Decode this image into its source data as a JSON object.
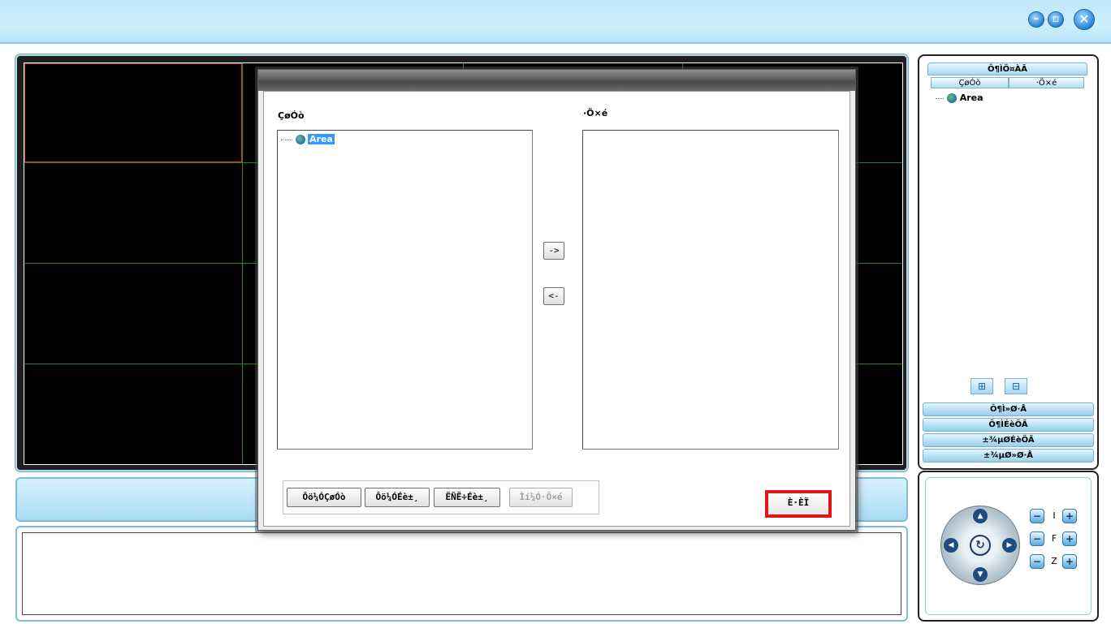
{
  "window": {
    "buttons": [
      {
        "name": "minimize",
        "glyph": "–"
      },
      {
        "name": "restore",
        "glyph": "▫"
      },
      {
        "name": "close",
        "glyph": "✕"
      }
    ]
  },
  "right_panel": {
    "header": "Ô¶ÌÖ¤ÀÃ",
    "tabs": [
      "ÇøÓò",
      "·Ö×é"
    ],
    "tree_root": "Area",
    "icon_buttons": [
      "tree-view-icon",
      "list-view-icon"
    ],
    "bars": [
      "Ô¶Ì»Ø·Å",
      "Ô¶ÌÉèÖÃ",
      "±¾µØÉèÖÃ",
      "±¾µØ»Ø·Å"
    ]
  },
  "ptz": {
    "arrows": {
      "up": "▲",
      "down": "▼",
      "left": "◀",
      "right": "▶"
    },
    "center_glyph": "↻",
    "rows": [
      {
        "label": "I",
        "minus": "−",
        "plus": "+"
      },
      {
        "label": "F",
        "minus": "−",
        "plus": "+"
      },
      {
        "label": "Z",
        "minus": "−",
        "plus": "+"
      }
    ]
  },
  "dialog": {
    "left_label": "ÇøÓò",
    "right_label": "·Ö×é",
    "tree_item": "Area",
    "add_button": "->",
    "remove_button": "<-",
    "bottom_buttons": [
      {
        "label": "Ôö¼ÓÇøÓò",
        "enabled": true
      },
      {
        "label": "Ôö¼ÓÉè±¸",
        "enabled": true
      },
      {
        "label": "ËÑË÷Éè±¸",
        "enabled": true
      },
      {
        "label": "Ìí¼Ó·Ö×é",
        "enabled": false
      }
    ],
    "ok_button": "È·ÈÏ"
  },
  "colors": {
    "accent": "#3399ff",
    "highlight": "#e01515",
    "grid": "#1f8a1f"
  }
}
